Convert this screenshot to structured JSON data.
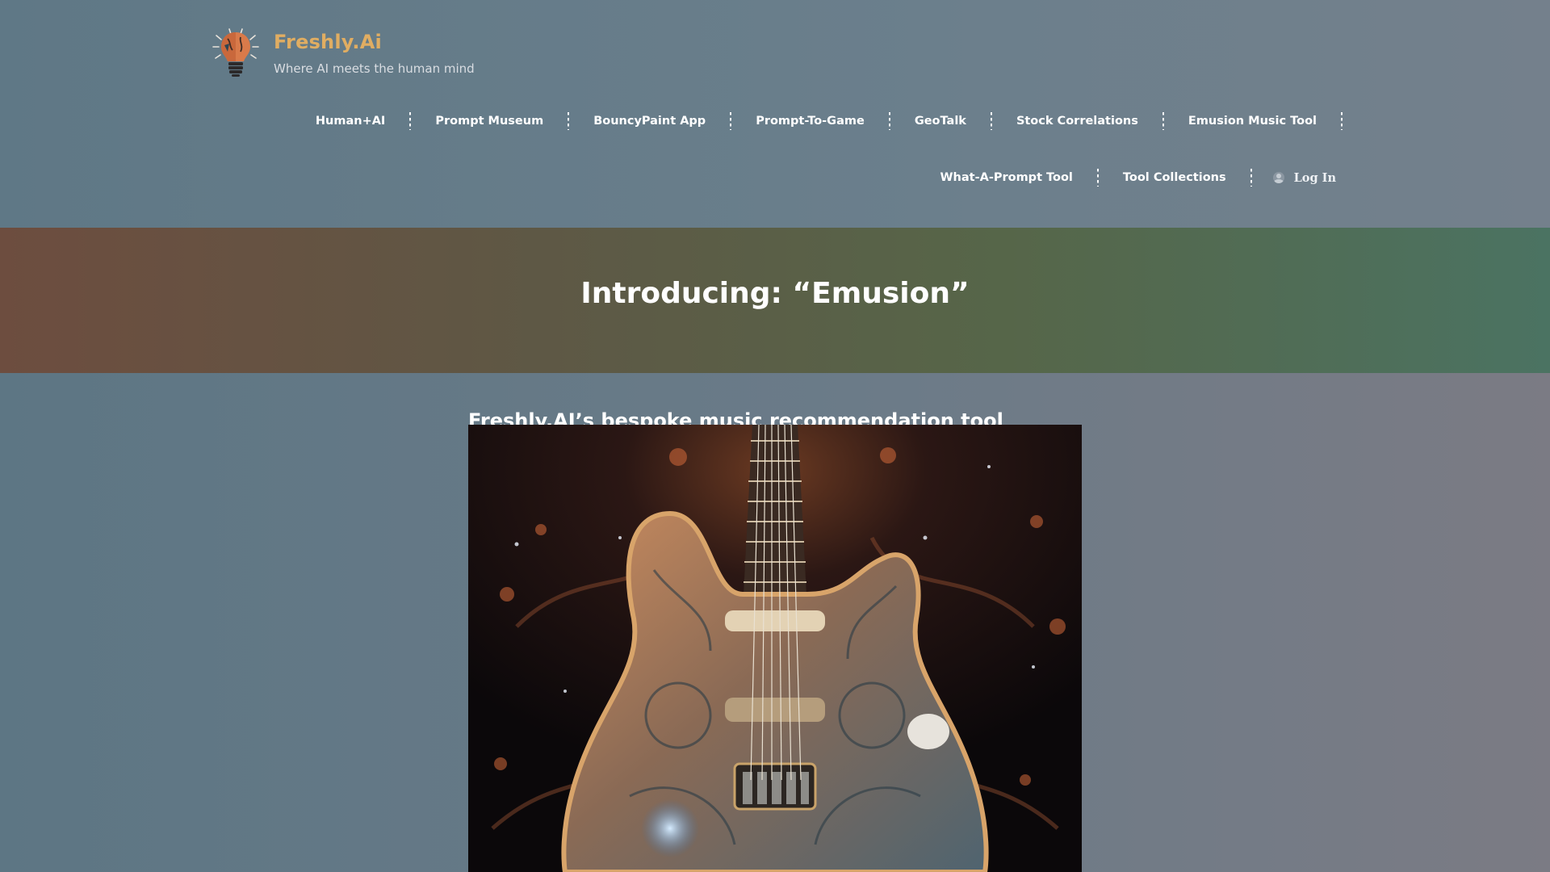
{
  "brand": {
    "name": "Freshly.Ai",
    "tagline": "Where AI meets the human mind",
    "logo_icon": "lightbulb-brain-icon",
    "name_color": "#e0ad62"
  },
  "nav": {
    "row1": [
      "Human+AI",
      "Prompt Museum",
      "BouncyPaint App",
      "Prompt-To-Game",
      "GeoTalk",
      "Stock Correlations",
      "Emusion Music Tool"
    ],
    "row2": [
      "What-A-Prompt Tool",
      "Tool Collections"
    ],
    "login_label": "Log In",
    "login_icon": "user-circle-icon"
  },
  "hero": {
    "title": "Introducing: “Emusion”"
  },
  "content": {
    "subtitle": "Freshly.AI’s bespoke music recommendation tool",
    "image_subject": "ornate-electric-guitar-image"
  },
  "colors": {
    "hero_left": "#6d4d3f",
    "hero_right": "#4b7362",
    "page_bg": "#687a87"
  }
}
